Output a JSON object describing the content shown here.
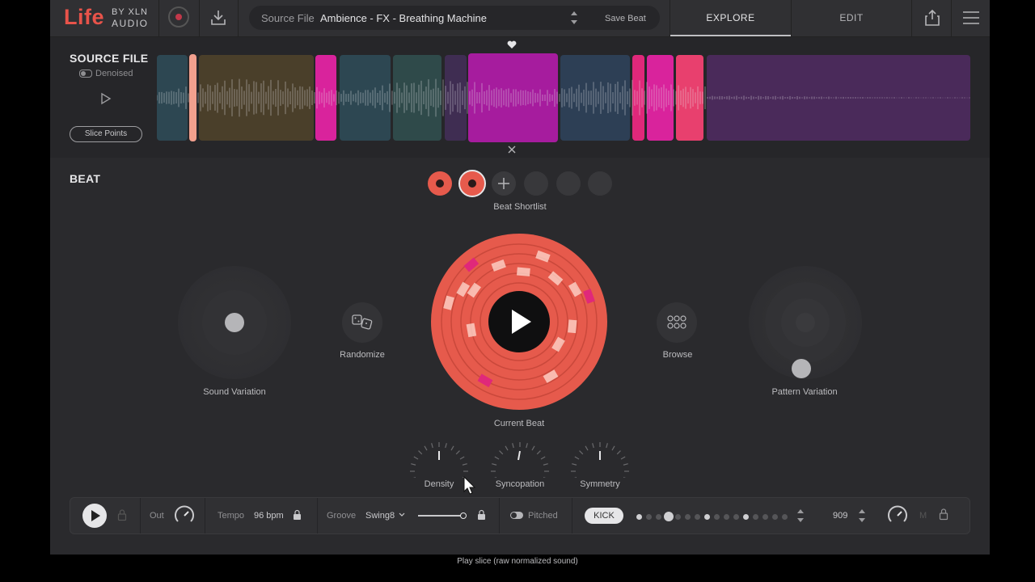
{
  "brand": {
    "name": "Life",
    "by": "BY XLN",
    "company": "AUDIO",
    "color": "#e8534a"
  },
  "topbar": {
    "source_label": "Source File",
    "source_value": "Ambience - FX - Breathing Machine",
    "save_label": "Save Beat",
    "tabs": [
      {
        "label": "EXPLORE",
        "active": true
      },
      {
        "label": "EDIT",
        "active": false
      }
    ]
  },
  "source_file": {
    "title": "SOURCE FILE",
    "denoise_label": "Denoised",
    "slice_points_label": "Slice Points",
    "segment_colors": [
      "#2d4752",
      "#4a3f2a",
      "#d9239c",
      "#2d4752",
      "#2f4a4a",
      "#3f2d52",
      "#a61c9e",
      "#2d3f55",
      "#e0287a",
      "#d9239c",
      "#e8406e",
      "#4a2a5a"
    ],
    "selected_slice_icon": "heart-icon",
    "close_icon": "close-icon"
  },
  "beat": {
    "title": "BEAT",
    "shortlist_label": "Beat Shortlist",
    "randomize_label": "Randomize",
    "browse_label": "Browse",
    "sound_variation_label": "Sound Variation",
    "pattern_variation_label": "Pattern Variation",
    "current_beat_label": "Current Beat",
    "knobs": [
      {
        "label": "Density"
      },
      {
        "label": "Syncopation"
      },
      {
        "label": "Symmetry"
      }
    ],
    "accent": "#e65a4c",
    "highlight": "#e0287a"
  },
  "footer": {
    "out_label": "Out",
    "tempo_label": "Tempo",
    "tempo_value": "96 bpm",
    "groove_label": "Groove",
    "groove_value": "Swing8",
    "pitched_label": "Pitched",
    "instrument_label": "KICK",
    "sequence_value": "909",
    "mute_label": "M"
  },
  "status": {
    "text": "Play slice (raw normalized sound)"
  }
}
